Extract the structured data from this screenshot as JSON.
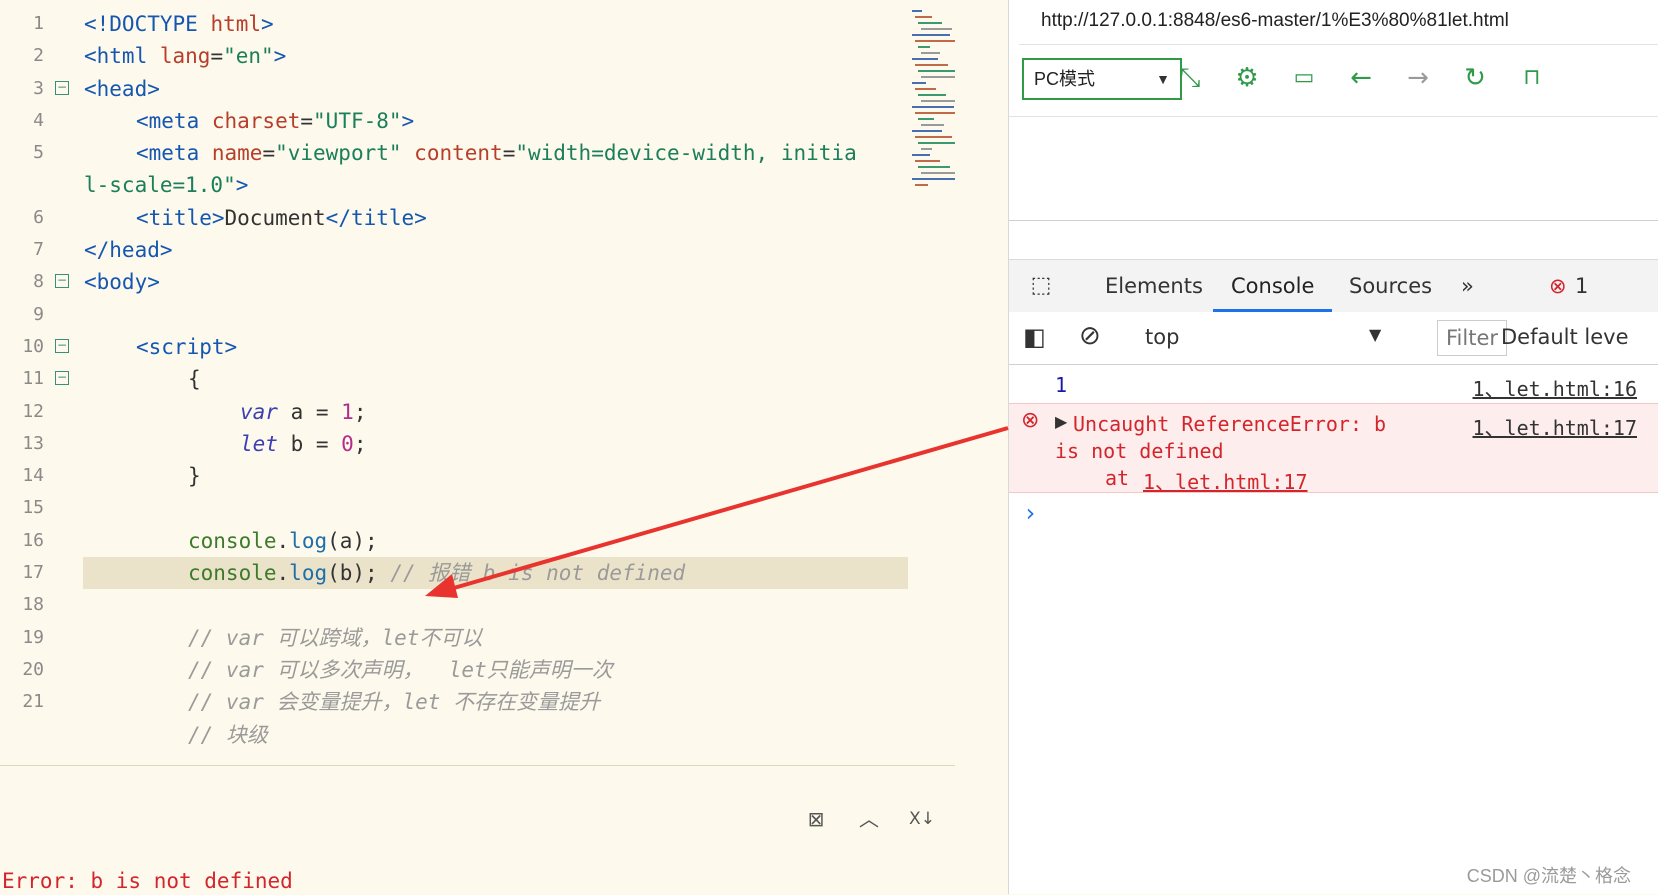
{
  "editor": {
    "lines": [
      {
        "n": "1",
        "segs": [
          {
            "c": "tag",
            "t": "<!DOCTYPE "
          },
          {
            "c": "attr",
            "t": "html"
          },
          {
            "c": "tag",
            "t": ">"
          }
        ]
      },
      {
        "n": "2",
        "segs": [
          {
            "c": "tag",
            "t": "<html "
          },
          {
            "c": "attr",
            "t": "lang"
          },
          {
            "c": "plain",
            "t": "="
          },
          {
            "c": "str",
            "t": "\"en\""
          },
          {
            "c": "tag",
            "t": ">"
          }
        ]
      },
      {
        "n": "3",
        "fold": true,
        "segs": [
          {
            "c": "tag",
            "t": "<head>"
          }
        ]
      },
      {
        "n": "4",
        "indent": 1,
        "segs": [
          {
            "c": "tag",
            "t": "<meta "
          },
          {
            "c": "attr",
            "t": "charset"
          },
          {
            "c": "plain",
            "t": "="
          },
          {
            "c": "str",
            "t": "\"UTF-8\""
          },
          {
            "c": "tag",
            "t": ">"
          }
        ]
      },
      {
        "n": "5",
        "indent": 1,
        "segs": [
          {
            "c": "tag",
            "t": "<meta "
          },
          {
            "c": "attr",
            "t": "name"
          },
          {
            "c": "plain",
            "t": "="
          },
          {
            "c": "str",
            "t": "\"viewport\" "
          },
          {
            "c": "attr",
            "t": "content"
          },
          {
            "c": "plain",
            "t": "="
          },
          {
            "c": "str",
            "t": "\"width=device-width, initia"
          }
        ]
      },
      {
        "n": "",
        "segs": [
          {
            "c": "str",
            "t": "l-scale=1.0\""
          },
          {
            "c": "tag",
            "t": ">"
          }
        ]
      },
      {
        "n": "6",
        "indent": 1,
        "segs": [
          {
            "c": "tag",
            "t": "<title>"
          },
          {
            "c": "plain",
            "t": "Document"
          },
          {
            "c": "tag",
            "t": "</title>"
          }
        ]
      },
      {
        "n": "7",
        "segs": [
          {
            "c": "tag",
            "t": "</head>"
          }
        ]
      },
      {
        "n": "8",
        "fold": true,
        "segs": [
          {
            "c": "tag",
            "t": "<body>"
          }
        ]
      },
      {
        "n": "9",
        "segs": []
      },
      {
        "n": "10",
        "fold": true,
        "indent": 1,
        "segs": [
          {
            "c": "tag",
            "t": "<script>"
          }
        ]
      },
      {
        "n": "11",
        "fold": true,
        "indent": 2,
        "segs": [
          {
            "c": "plain",
            "t": "{"
          }
        ]
      },
      {
        "n": "12",
        "indent": 3,
        "segs": [
          {
            "c": "kw",
            "t": "var"
          },
          {
            "c": "plain",
            "t": " a = "
          },
          {
            "c": "num",
            "t": "1"
          },
          {
            "c": "plain",
            "t": ";"
          }
        ]
      },
      {
        "n": "13",
        "indent": 3,
        "segs": [
          {
            "c": "kw",
            "t": "let"
          },
          {
            "c": "plain",
            "t": " b = "
          },
          {
            "c": "num",
            "t": "0"
          },
          {
            "c": "plain",
            "t": ";"
          }
        ]
      },
      {
        "n": "14",
        "indent": 2,
        "segs": [
          {
            "c": "plain",
            "t": "}"
          }
        ]
      },
      {
        "n": "15",
        "segs": []
      },
      {
        "n": "16",
        "indent": 2,
        "segs": [
          {
            "c": "obj",
            "t": "console"
          },
          {
            "c": "plain",
            "t": "."
          },
          {
            "c": "fn",
            "t": "log"
          },
          {
            "c": "plain",
            "t": "(a);"
          }
        ]
      },
      {
        "n": "17",
        "indent": 2,
        "highlight": true,
        "segs": [
          {
            "c": "obj",
            "t": "console"
          },
          {
            "c": "plain",
            "t": "."
          },
          {
            "c": "fn",
            "t": "log"
          },
          {
            "c": "plain",
            "t": "(b); "
          },
          {
            "c": "com",
            "t": "// 报错 b is not defined"
          }
        ]
      },
      {
        "n": "18",
        "segs": []
      },
      {
        "n": "19",
        "indent": 2,
        "segs": [
          {
            "c": "com",
            "t": "// var 可以跨域，let不可以"
          }
        ]
      },
      {
        "n": "20",
        "indent": 2,
        "segs": [
          {
            "c": "com",
            "t": "// var 可以多次声明，  let只能声明一次"
          }
        ]
      },
      {
        "n": "21",
        "indent": 2,
        "segs": [
          {
            "c": "com",
            "t": "// var 会变量提升，let 不存在变量提升"
          }
        ]
      },
      {
        "n": "",
        "indent": 2,
        "segs": [
          {
            "c": "com",
            "t": "// 块级"
          }
        ]
      }
    ],
    "error_text": "Error: b is not defined"
  },
  "browser": {
    "url": "http://127.0.0.1:8848/es6-master/1%E3%80%81let.html",
    "mode": "PC模式",
    "icons": [
      "resize-icon",
      "gear-icon",
      "terminal-icon",
      "back-arrow-icon",
      "forward-arrow-icon",
      "refresh-icon",
      "unlock-icon"
    ],
    "devtools": {
      "tabs": [
        "Elements",
        "Console",
        "Sources"
      ],
      "more": "»",
      "error_count": "1",
      "context": "top",
      "filter_placeholder": "Filter",
      "levels": "Default leve",
      "console": {
        "log_value": "1",
        "log_source": "1、let.html:16",
        "error_line1": "Uncaught ReferenceError: b",
        "error_line2": "is not defined",
        "error_at": "at ",
        "error_at_link": "1、let.html:17",
        "error_source": "1、let.html:17",
        "prompt": "›"
      }
    }
  },
  "watermark": "CSDN @流楚丶格念",
  "accent_colors": {
    "green": "#2f9a48",
    "blue": "#1a73e8",
    "error": "#d3252b",
    "arrow": "#e8332e"
  }
}
